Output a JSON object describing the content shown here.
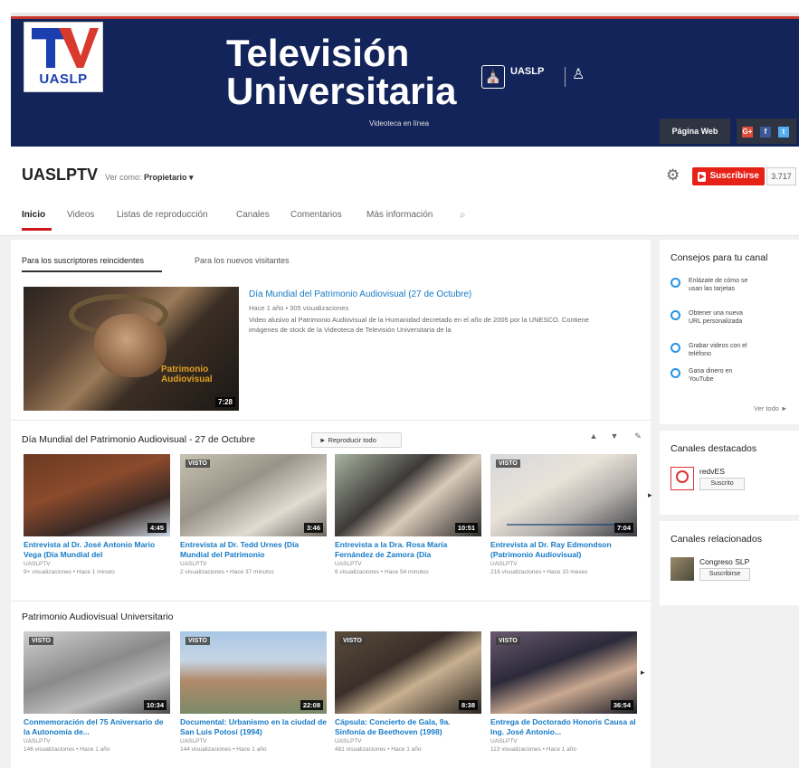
{
  "banner": {
    "logo_text": "UASLP",
    "title_line1": "Televisión",
    "title_line2": "Universitaria",
    "subtitle": "Videoteca en línea",
    "university": "UASLP",
    "web_button": "Página Web",
    "social": [
      "G+",
      "f",
      "t"
    ]
  },
  "channel": {
    "name": "UASLPTV",
    "view_as_label": "Ver como:",
    "view_as_value": "Propietario ▾",
    "subscribe_label": "Suscribirse",
    "subscriber_count": "3.717"
  },
  "nav": {
    "tabs": [
      "Inicio",
      "Videos",
      "Listas de reproducción",
      "Canales",
      "Comentarios",
      "Más información"
    ]
  },
  "subtabs": [
    "Para los suscriptores reincidentes",
    "Para los nuevos visitantes"
  ],
  "featured": {
    "title": "Día Mundial del Patrimonio Audiovisual (27 de Octubre)",
    "meta": "Hace 1 año • 305 visualizaciones",
    "description": "Video alusivo al Patrimonio Audiovisual de la Humanidad decretado en el año de 2005 por la UNESCO. Contiene imágenes de stock de la Videoteca de Televisión Universitaria de la",
    "overlay_line1": "Patrimonio",
    "overlay_line2": "Audiovisual",
    "duration": "7:28"
  },
  "shelf1": {
    "title": "Día Mundial del Patrimonio Audiovisual - 27 de Octubre",
    "play_all": "► Reproducir todo",
    "videos": [
      {
        "title": "Entrevista al Dr. José Antonio Mario Vega (Día Mundial del",
        "channel": "UASLPTV",
        "meta": "9+ visualizaciones • Hace 1 minuto",
        "duration": "4:45",
        "badge": ""
      },
      {
        "title": "Entrevista al Dr. Tedd Urnes (Día Mundial del Patrimonio",
        "channel": "UASLPTV",
        "meta": "2 visualizaciones • Hace 37 minutos",
        "duration": "3:46",
        "badge": "VISTO"
      },
      {
        "title": "Entrevista a la Dra. Rosa María Fernández de Zamora (Día",
        "channel": "UASLPTV",
        "meta": "6 visualizaciones • Hace 54 minutos",
        "duration": "10:51",
        "badge": ""
      },
      {
        "title": "Entrevista al Dr. Ray Edmondson (Patrimonio Audiovisual)",
        "channel": "UASLPTV",
        "meta": "216 visualizaciones • Hace 10 meses",
        "duration": "7:04",
        "badge": "VISTO"
      }
    ]
  },
  "shelf2": {
    "title": "Patrimonio Audiovisual Universitario",
    "videos": [
      {
        "title": "Conmemoración del 75 Aniversario de la Autonomía de...",
        "channel": "UASLPTV",
        "meta": "146 visualizaciones • Hace 1 año",
        "duration": "10:34",
        "badge": "VISTO"
      },
      {
        "title": "Documental: Urbanismo en la ciudad de San Luis Potosí (1994)",
        "channel": "UASLPTV",
        "meta": "144 visualizaciones • Hace 1 año",
        "duration": "22:08",
        "badge": "VISTO"
      },
      {
        "title": "Cápsula: Concierto de Gala, 9a. Sinfonía de Beethoven (1998)",
        "channel": "UASLPTV",
        "meta": "481 visualizaciones • Hace 1 año",
        "duration": "8:38",
        "badge": "VISTO"
      },
      {
        "title": "Entrega de Doctorado Honoris Causa al Ing. José Antonio...",
        "channel": "UASLPTV",
        "meta": "113 visualizaciones • Hace 1 año",
        "duration": "36:54",
        "badge": "VISTO"
      }
    ]
  },
  "sidebar": {
    "tips_title": "Consejos para tu canal",
    "tips": [
      "Enlázate de cómo se usan las tarjetas",
      "Obtener una nueva URL personalizada",
      "Grabar videos con el teléfono",
      "Gana dinero en YouTube"
    ],
    "see_all": "Ver todo ►",
    "featured_title": "Canales destacados",
    "featured_channel": "redvES",
    "featured_btn": "Suscrito",
    "related_title": "Canales relacionados",
    "related_channel": "Congreso SLP",
    "related_btn": "Suscribirse"
  }
}
